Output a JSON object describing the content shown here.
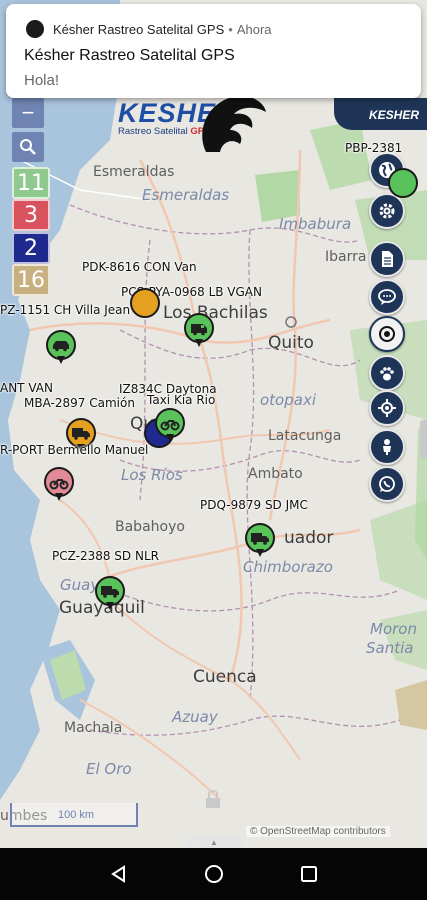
{
  "notification": {
    "app_name": "Késher Rastreo Satelital GPS",
    "time": "Ahora",
    "title": "Késher Rastreo Satelital GPS",
    "body": "Hola!"
  },
  "logo": {
    "brand": "KESHER",
    "tagline": "Rastreo Satelital",
    "tagline_gps": "GPS",
    "corner_brand": "KESHER"
  },
  "map_controls": {
    "zoom_out": "−",
    "search_icon": "search-icon"
  },
  "counters": [
    {
      "value": "11",
      "color": "#8fc98e"
    },
    {
      "value": "3",
      "color": "#d9535f"
    },
    {
      "value": "2",
      "color": "#1f2a8e"
    },
    {
      "value": "16",
      "color": "#c8b181"
    }
  ],
  "tools": [
    {
      "name": "globe-icon"
    },
    {
      "name": "gear-icon"
    },
    {
      "name": "document-icon"
    },
    {
      "name": "chat-icon"
    },
    {
      "name": "target-icon"
    },
    {
      "name": "paw-icon"
    },
    {
      "name": "crosshair-icon"
    },
    {
      "name": "person-icon"
    },
    {
      "name": "whatsapp-icon"
    }
  ],
  "places": {
    "esmeraldas_city": "Esmeraldas",
    "esmeraldas_region": "Esmeraldas",
    "imbabura": "Imbabura",
    "ibarra": "Ibarra",
    "los_bachilas": "Los Bachilas",
    "quito": "Quito",
    "cotopaxi": "otopaxi",
    "quevedo": "Que",
    "latacunga": "Latacunga",
    "los_rios": "Los Ríos",
    "ambato": "Ambato",
    "babahoyo": "Babahoyo",
    "ecuador": "uador",
    "chimborazo": "Chimborazo",
    "guayas": "Guayas",
    "guayaquil": "Guayaquil",
    "cuenca": "Cuenca",
    "azuay": "Azuay",
    "morona_a": "Moron",
    "morona_b": "Santia",
    "machala": "Machala",
    "el_oro": "El Oro",
    "tumbes": "umbes"
  },
  "vehicles": [
    {
      "label": "PBP-2381",
      "color": "#59c25b"
    },
    {
      "label": "PDK-8616 CON Van",
      "color": "#e6a020"
    },
    {
      "label": "PCS-PYA-0968 LB VGAN",
      "color": "#59c25b"
    },
    {
      "label": "PZ-1151 CH Villa Jean",
      "color": "#59c25b"
    },
    {
      "label": "ANT VAN",
      "color": "#e6a020"
    },
    {
      "label": "IZ834C Daytona",
      "color": "#59c25b"
    },
    {
      "label": "MBA-2897 Camión",
      "color": "#e6a020"
    },
    {
      "label": "Taxi Kia Rio",
      "color": "#1f2a8e"
    },
    {
      "label": "R-PORT Bermello Manuel",
      "color": "#d9535f"
    },
    {
      "label": "PDQ-9879 SD JMC",
      "color": "#59c25b"
    },
    {
      "label": "PCZ-2388 SD NLR",
      "color": "#59c25b"
    }
  ],
  "scale": {
    "label": "100 km"
  },
  "attribution": "© OpenStreetMap contributors",
  "navbar": {
    "back": "back-icon",
    "home": "home-icon",
    "recents": "recents-icon"
  }
}
